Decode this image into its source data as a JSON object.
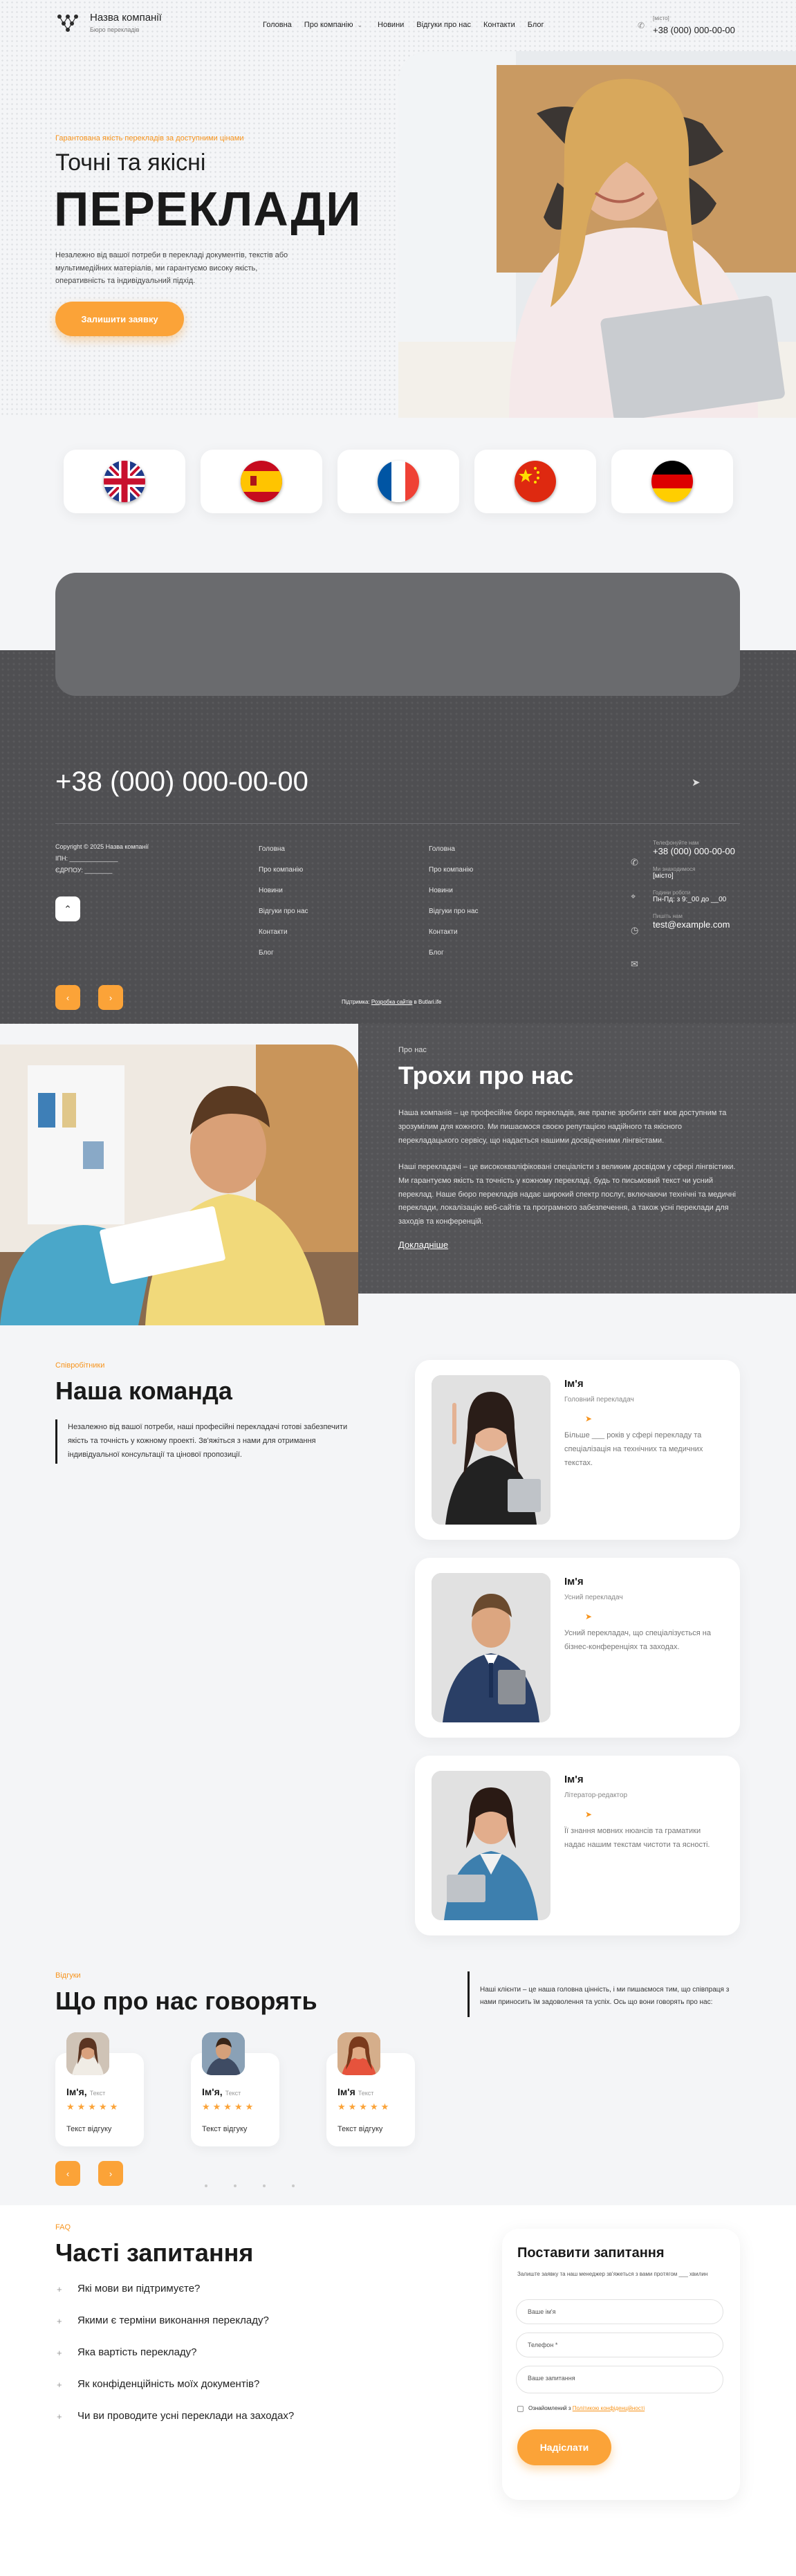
{
  "header": {
    "company_name": "Назва компанії",
    "company_sub": "Бюро перекладів",
    "nav": [
      "Головна",
      "Про компанію",
      "Новини",
      "Відгуки про нас",
      "Контакти",
      "Блог"
    ],
    "nav_dropdown_icon": "chevron-down-icon",
    "phone_label": "[місто]",
    "phone": "+38 (000) 000-00-00"
  },
  "hero": {
    "eyebrow": "Гарантована якість перекладів за доступними цінами",
    "title_small": "Точні та якісні",
    "title_big": "ПЕРЕКЛАДИ",
    "description": "Незалежно від вашої потреби в перекладі документів, текстів або мультимедійних матеріалів, ми гарантуємо високу якість, оперативність та індивідуальний підхід.",
    "cta": "Залишити заявку"
  },
  "flags": [
    "flag-uk-icon",
    "flag-spain-icon",
    "flag-france-icon",
    "flag-china-icon",
    "flag-germany-icon"
  ],
  "footer": {
    "phone_big": "+38 (000) 000-00-00",
    "send_icon": "paper-plane-icon",
    "copyright": "Copyright © 2025 Назва компанії",
    "inn": "ІПН: ______________",
    "edrpou": "ЄДРПОУ: ________",
    "col1": [
      "Головна",
      "Про компанію",
      "Новини",
      "Відгуки про нас",
      "Контакти",
      "Блог"
    ],
    "col2": [
      "Головна",
      "Про компанію",
      "Новини",
      "Відгуки про нас",
      "Контакти",
      "Блог"
    ],
    "contact_phone_label": "Телефонуйте нам",
    "contact_phone": "+38 (000) 000-00-00",
    "contact_addr_label": "Ми знаходимося",
    "contact_addr": "[місто]",
    "contact_hours_label": "Години роботи",
    "contact_hours": "Пн-Пд: з 9:_00 до __00",
    "contact_email_label": "Пишіть нам",
    "contact_email": "test@example.com",
    "credit_prefix": "Підтримка:",
    "credit_link": "Розробка сайтів",
    "credit_suffix": "в Butlari.ife"
  },
  "about": {
    "eyebrow": "Про нас",
    "title": "Трохи про нас",
    "p1": "Наша компанія – це професійне бюро перекладів, яке прагне зробити світ мов доступним та зрозумілим для кожного. Ми пишаємося своєю репутацією надійного та якісного перекладацького сервісу, що надається нашими досвідченими лінгвістами.",
    "p2": "Наші перекладачі – це висококваліфіковані спеціалісти з великим досвідом у сфері лінгвістики. Ми гарантуємо якість та точність у кожному перекладі, будь то письмовий текст чи усний переклад. Наше бюро перекладів надає широкий спектр послуг, включаючи технічні та медичні переклади, локалізацію веб-сайтів та програмного забезпечення, а також усні переклади для заходів та конференцій.",
    "link": "Докладніше"
  },
  "team": {
    "eyebrow": "Співробітники",
    "title": "Наша команда",
    "description": "Незалежно від вашої потреби, наші професійні перекладачі готові забезпечити якість та точність у кожному проекті. Зв'яжіться з нами для отримання індивідуальної консультації та цінової пропозиції.",
    "members": [
      {
        "name": "Ім'я",
        "role": "Головний перекладач",
        "desc": "Більше ___ років у сфері перекладу та спеціалізація на технічних та медичних текстах."
      },
      {
        "name": "Ім'я",
        "role": "Усний перекладач",
        "desc": "Усний перекладач, що спеціалізується на бізнес-конференціях та заходах."
      },
      {
        "name": "Ім'я",
        "role": "Літератор-редактор",
        "desc": "Її знання мовних нюансів та граматики надає нашим текстам чистоти та ясності."
      }
    ]
  },
  "reviews": {
    "eyebrow": "Відгуки",
    "title": "Що про нас говорять",
    "description": "Наші клієнти – це наша головна цінність, і ми пишаємося тим, що співпраця з нами приносить їм задоволення та успіх. Ось що вони говорять про нас:",
    "items": [
      {
        "name": "Ім'я,",
        "meta": "Текст",
        "stars": "★★★★★",
        "text": "Текст відгуку"
      },
      {
        "name": "Ім'я,",
        "meta": "Текст",
        "stars": "★★★★★",
        "text": "Текст відгуку"
      },
      {
        "name": "Ім'я",
        "meta": "Текст",
        "stars": "★★★★★",
        "text": "Текст відгуку"
      }
    ]
  },
  "faq": {
    "eyebrow": "FAQ",
    "title": "Часті запитання",
    "questions": [
      "Які мови ви підтримуєте?",
      "Якими є терміни виконання перекладу?",
      "Яка вартість перекладу?",
      "Як конфіденційність моїх документів?",
      "Чи ви проводите усні переклади на заходах?"
    ]
  },
  "form": {
    "title": "Поставити запитання",
    "subtitle": "Залиште заявку та наш менеджер зв'яжеться з вами протягом ___ хвилин",
    "name_placeholder": "Ваше ім'я",
    "phone_placeholder": "Телефон *",
    "question_placeholder": "Ваше запитання",
    "consent_prefix": "Ознайомлений з",
    "consent_link": "Політикою конфіденційності",
    "submit": "Надіслати"
  },
  "colors": {
    "accent": "#fba338",
    "dark": "#4f4f52",
    "text": "#1a1a1a"
  }
}
